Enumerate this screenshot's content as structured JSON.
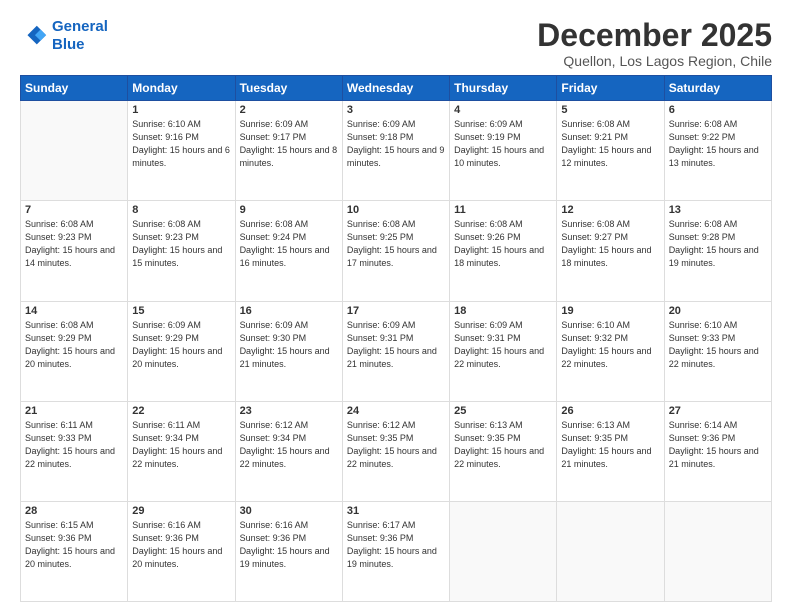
{
  "logo": {
    "line1": "General",
    "line2": "Blue"
  },
  "header": {
    "title": "December 2025",
    "subtitle": "Quellon, Los Lagos Region, Chile"
  },
  "weekdays": [
    "Sunday",
    "Monday",
    "Tuesday",
    "Wednesday",
    "Thursday",
    "Friday",
    "Saturday"
  ],
  "weeks": [
    [
      {
        "day": "",
        "sunrise": "",
        "sunset": "",
        "daylight": ""
      },
      {
        "day": "1",
        "sunrise": "Sunrise: 6:10 AM",
        "sunset": "Sunset: 9:16 PM",
        "daylight": "Daylight: 15 hours and 6 minutes."
      },
      {
        "day": "2",
        "sunrise": "Sunrise: 6:09 AM",
        "sunset": "Sunset: 9:17 PM",
        "daylight": "Daylight: 15 hours and 8 minutes."
      },
      {
        "day": "3",
        "sunrise": "Sunrise: 6:09 AM",
        "sunset": "Sunset: 9:18 PM",
        "daylight": "Daylight: 15 hours and 9 minutes."
      },
      {
        "day": "4",
        "sunrise": "Sunrise: 6:09 AM",
        "sunset": "Sunset: 9:19 PM",
        "daylight": "Daylight: 15 hours and 10 minutes."
      },
      {
        "day": "5",
        "sunrise": "Sunrise: 6:08 AM",
        "sunset": "Sunset: 9:21 PM",
        "daylight": "Daylight: 15 hours and 12 minutes."
      },
      {
        "day": "6",
        "sunrise": "Sunrise: 6:08 AM",
        "sunset": "Sunset: 9:22 PM",
        "daylight": "Daylight: 15 hours and 13 minutes."
      }
    ],
    [
      {
        "day": "7",
        "sunrise": "Sunrise: 6:08 AM",
        "sunset": "Sunset: 9:23 PM",
        "daylight": "Daylight: 15 hours and 14 minutes."
      },
      {
        "day": "8",
        "sunrise": "Sunrise: 6:08 AM",
        "sunset": "Sunset: 9:23 PM",
        "daylight": "Daylight: 15 hours and 15 minutes."
      },
      {
        "day": "9",
        "sunrise": "Sunrise: 6:08 AM",
        "sunset": "Sunset: 9:24 PM",
        "daylight": "Daylight: 15 hours and 16 minutes."
      },
      {
        "day": "10",
        "sunrise": "Sunrise: 6:08 AM",
        "sunset": "Sunset: 9:25 PM",
        "daylight": "Daylight: 15 hours and 17 minutes."
      },
      {
        "day": "11",
        "sunrise": "Sunrise: 6:08 AM",
        "sunset": "Sunset: 9:26 PM",
        "daylight": "Daylight: 15 hours and 18 minutes."
      },
      {
        "day": "12",
        "sunrise": "Sunrise: 6:08 AM",
        "sunset": "Sunset: 9:27 PM",
        "daylight": "Daylight: 15 hours and 18 minutes."
      },
      {
        "day": "13",
        "sunrise": "Sunrise: 6:08 AM",
        "sunset": "Sunset: 9:28 PM",
        "daylight": "Daylight: 15 hours and 19 minutes."
      }
    ],
    [
      {
        "day": "14",
        "sunrise": "Sunrise: 6:08 AM",
        "sunset": "Sunset: 9:29 PM",
        "daylight": "Daylight: 15 hours and 20 minutes."
      },
      {
        "day": "15",
        "sunrise": "Sunrise: 6:09 AM",
        "sunset": "Sunset: 9:29 PM",
        "daylight": "Daylight: 15 hours and 20 minutes."
      },
      {
        "day": "16",
        "sunrise": "Sunrise: 6:09 AM",
        "sunset": "Sunset: 9:30 PM",
        "daylight": "Daylight: 15 hours and 21 minutes."
      },
      {
        "day": "17",
        "sunrise": "Sunrise: 6:09 AM",
        "sunset": "Sunset: 9:31 PM",
        "daylight": "Daylight: 15 hours and 21 minutes."
      },
      {
        "day": "18",
        "sunrise": "Sunrise: 6:09 AM",
        "sunset": "Sunset: 9:31 PM",
        "daylight": "Daylight: 15 hours and 22 minutes."
      },
      {
        "day": "19",
        "sunrise": "Sunrise: 6:10 AM",
        "sunset": "Sunset: 9:32 PM",
        "daylight": "Daylight: 15 hours and 22 minutes."
      },
      {
        "day": "20",
        "sunrise": "Sunrise: 6:10 AM",
        "sunset": "Sunset: 9:33 PM",
        "daylight": "Daylight: 15 hours and 22 minutes."
      }
    ],
    [
      {
        "day": "21",
        "sunrise": "Sunrise: 6:11 AM",
        "sunset": "Sunset: 9:33 PM",
        "daylight": "Daylight: 15 hours and 22 minutes."
      },
      {
        "day": "22",
        "sunrise": "Sunrise: 6:11 AM",
        "sunset": "Sunset: 9:34 PM",
        "daylight": "Daylight: 15 hours and 22 minutes."
      },
      {
        "day": "23",
        "sunrise": "Sunrise: 6:12 AM",
        "sunset": "Sunset: 9:34 PM",
        "daylight": "Daylight: 15 hours and 22 minutes."
      },
      {
        "day": "24",
        "sunrise": "Sunrise: 6:12 AM",
        "sunset": "Sunset: 9:35 PM",
        "daylight": "Daylight: 15 hours and 22 minutes."
      },
      {
        "day": "25",
        "sunrise": "Sunrise: 6:13 AM",
        "sunset": "Sunset: 9:35 PM",
        "daylight": "Daylight: 15 hours and 22 minutes."
      },
      {
        "day": "26",
        "sunrise": "Sunrise: 6:13 AM",
        "sunset": "Sunset: 9:35 PM",
        "daylight": "Daylight: 15 hours and 21 minutes."
      },
      {
        "day": "27",
        "sunrise": "Sunrise: 6:14 AM",
        "sunset": "Sunset: 9:36 PM",
        "daylight": "Daylight: 15 hours and 21 minutes."
      }
    ],
    [
      {
        "day": "28",
        "sunrise": "Sunrise: 6:15 AM",
        "sunset": "Sunset: 9:36 PM",
        "daylight": "Daylight: 15 hours and 20 minutes."
      },
      {
        "day": "29",
        "sunrise": "Sunrise: 6:16 AM",
        "sunset": "Sunset: 9:36 PM",
        "daylight": "Daylight: 15 hours and 20 minutes."
      },
      {
        "day": "30",
        "sunrise": "Sunrise: 6:16 AM",
        "sunset": "Sunset: 9:36 PM",
        "daylight": "Daylight: 15 hours and 19 minutes."
      },
      {
        "day": "31",
        "sunrise": "Sunrise: 6:17 AM",
        "sunset": "Sunset: 9:36 PM",
        "daylight": "Daylight: 15 hours and 19 minutes."
      },
      {
        "day": "",
        "sunrise": "",
        "sunset": "",
        "daylight": ""
      },
      {
        "day": "",
        "sunrise": "",
        "sunset": "",
        "daylight": ""
      },
      {
        "day": "",
        "sunrise": "",
        "sunset": "",
        "daylight": ""
      }
    ]
  ]
}
